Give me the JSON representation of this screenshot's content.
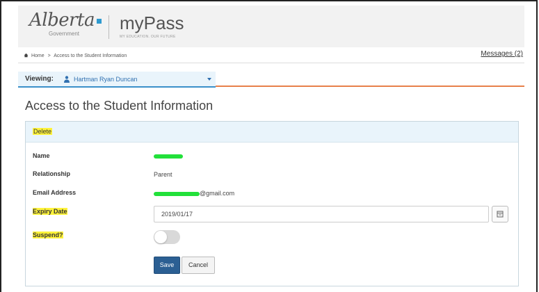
{
  "header": {
    "brand_alberta": "Alberta",
    "brand_government": "Government",
    "brand_app": "myPass",
    "brand_tagline": "MY EDUCATION. OUR FUTURE"
  },
  "breadcrumb": {
    "home": "Home",
    "separator": ">",
    "current": "Access to the Student Information"
  },
  "messages_link": "Messages (2)",
  "viewing": {
    "label": "Viewing:",
    "name": "Hartman Ryan Duncan"
  },
  "page_title": "Access to the Student Information",
  "panel": {
    "delete_label": "Delete",
    "fields": {
      "name_label": "Name",
      "relationship_label": "Relationship",
      "relationship_value": "Parent",
      "email_label": "Email Address",
      "email_suffix": "@gmail.com",
      "expiry_label": "Expiry Date",
      "expiry_value": "2019/01/17",
      "suspend_label": "Suspend?"
    },
    "suspend_on": false,
    "save_label": "Save",
    "cancel_label": "Cancel"
  },
  "colors": {
    "highlight": "#fff33a",
    "redaction": "#22e03a",
    "accent_orange": "#e8804a",
    "primary_button": "#2b5f93"
  },
  "icons": [
    "home-icon",
    "person-icon",
    "chevron-down-icon",
    "calendar-icon"
  ]
}
